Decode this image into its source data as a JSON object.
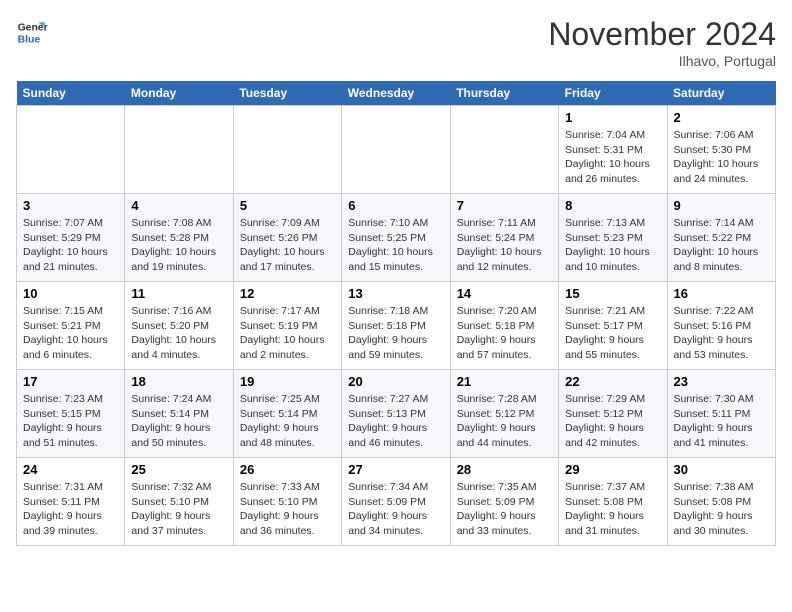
{
  "header": {
    "logo_line1": "General",
    "logo_line2": "Blue",
    "month_title": "November 2024",
    "location": "Ilhavo, Portugal"
  },
  "days_of_week": [
    "Sunday",
    "Monday",
    "Tuesday",
    "Wednesday",
    "Thursday",
    "Friday",
    "Saturday"
  ],
  "weeks": [
    [
      {
        "day": "",
        "detail": ""
      },
      {
        "day": "",
        "detail": ""
      },
      {
        "day": "",
        "detail": ""
      },
      {
        "day": "",
        "detail": ""
      },
      {
        "day": "",
        "detail": ""
      },
      {
        "day": "1",
        "detail": "Sunrise: 7:04 AM\nSunset: 5:31 PM\nDaylight: 10 hours and 26 minutes."
      },
      {
        "day": "2",
        "detail": "Sunrise: 7:06 AM\nSunset: 5:30 PM\nDaylight: 10 hours and 24 minutes."
      }
    ],
    [
      {
        "day": "3",
        "detail": "Sunrise: 7:07 AM\nSunset: 5:29 PM\nDaylight: 10 hours and 21 minutes."
      },
      {
        "day": "4",
        "detail": "Sunrise: 7:08 AM\nSunset: 5:28 PM\nDaylight: 10 hours and 19 minutes."
      },
      {
        "day": "5",
        "detail": "Sunrise: 7:09 AM\nSunset: 5:26 PM\nDaylight: 10 hours and 17 minutes."
      },
      {
        "day": "6",
        "detail": "Sunrise: 7:10 AM\nSunset: 5:25 PM\nDaylight: 10 hours and 15 minutes."
      },
      {
        "day": "7",
        "detail": "Sunrise: 7:11 AM\nSunset: 5:24 PM\nDaylight: 10 hours and 12 minutes."
      },
      {
        "day": "8",
        "detail": "Sunrise: 7:13 AM\nSunset: 5:23 PM\nDaylight: 10 hours and 10 minutes."
      },
      {
        "day": "9",
        "detail": "Sunrise: 7:14 AM\nSunset: 5:22 PM\nDaylight: 10 hours and 8 minutes."
      }
    ],
    [
      {
        "day": "10",
        "detail": "Sunrise: 7:15 AM\nSunset: 5:21 PM\nDaylight: 10 hours and 6 minutes."
      },
      {
        "day": "11",
        "detail": "Sunrise: 7:16 AM\nSunset: 5:20 PM\nDaylight: 10 hours and 4 minutes."
      },
      {
        "day": "12",
        "detail": "Sunrise: 7:17 AM\nSunset: 5:19 PM\nDaylight: 10 hours and 2 minutes."
      },
      {
        "day": "13",
        "detail": "Sunrise: 7:18 AM\nSunset: 5:18 PM\nDaylight: 9 hours and 59 minutes."
      },
      {
        "day": "14",
        "detail": "Sunrise: 7:20 AM\nSunset: 5:18 PM\nDaylight: 9 hours and 57 minutes."
      },
      {
        "day": "15",
        "detail": "Sunrise: 7:21 AM\nSunset: 5:17 PM\nDaylight: 9 hours and 55 minutes."
      },
      {
        "day": "16",
        "detail": "Sunrise: 7:22 AM\nSunset: 5:16 PM\nDaylight: 9 hours and 53 minutes."
      }
    ],
    [
      {
        "day": "17",
        "detail": "Sunrise: 7:23 AM\nSunset: 5:15 PM\nDaylight: 9 hours and 51 minutes."
      },
      {
        "day": "18",
        "detail": "Sunrise: 7:24 AM\nSunset: 5:14 PM\nDaylight: 9 hours and 50 minutes."
      },
      {
        "day": "19",
        "detail": "Sunrise: 7:25 AM\nSunset: 5:14 PM\nDaylight: 9 hours and 48 minutes."
      },
      {
        "day": "20",
        "detail": "Sunrise: 7:27 AM\nSunset: 5:13 PM\nDaylight: 9 hours and 46 minutes."
      },
      {
        "day": "21",
        "detail": "Sunrise: 7:28 AM\nSunset: 5:12 PM\nDaylight: 9 hours and 44 minutes."
      },
      {
        "day": "22",
        "detail": "Sunrise: 7:29 AM\nSunset: 5:12 PM\nDaylight: 9 hours and 42 minutes."
      },
      {
        "day": "23",
        "detail": "Sunrise: 7:30 AM\nSunset: 5:11 PM\nDaylight: 9 hours and 41 minutes."
      }
    ],
    [
      {
        "day": "24",
        "detail": "Sunrise: 7:31 AM\nSunset: 5:11 PM\nDaylight: 9 hours and 39 minutes."
      },
      {
        "day": "25",
        "detail": "Sunrise: 7:32 AM\nSunset: 5:10 PM\nDaylight: 9 hours and 37 minutes."
      },
      {
        "day": "26",
        "detail": "Sunrise: 7:33 AM\nSunset: 5:10 PM\nDaylight: 9 hours and 36 minutes."
      },
      {
        "day": "27",
        "detail": "Sunrise: 7:34 AM\nSunset: 5:09 PM\nDaylight: 9 hours and 34 minutes."
      },
      {
        "day": "28",
        "detail": "Sunrise: 7:35 AM\nSunset: 5:09 PM\nDaylight: 9 hours and 33 minutes."
      },
      {
        "day": "29",
        "detail": "Sunrise: 7:37 AM\nSunset: 5:08 PM\nDaylight: 9 hours and 31 minutes."
      },
      {
        "day": "30",
        "detail": "Sunrise: 7:38 AM\nSunset: 5:08 PM\nDaylight: 9 hours and 30 minutes."
      }
    ]
  ]
}
